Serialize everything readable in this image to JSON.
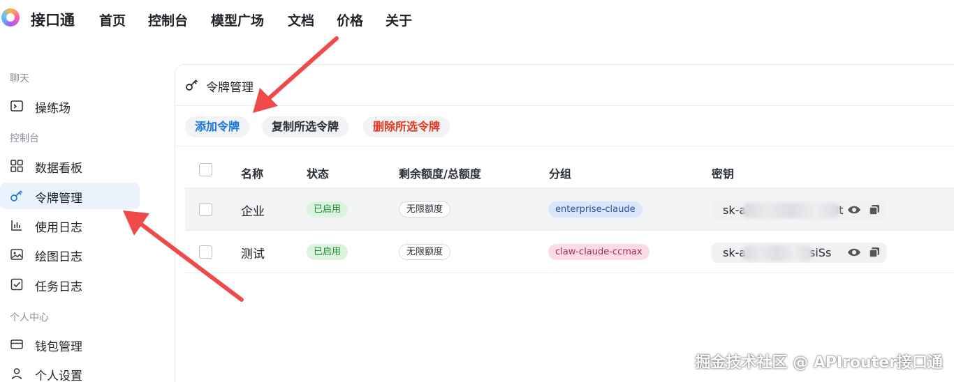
{
  "nav": {
    "brand": "接口通",
    "items": [
      "首页",
      "控制台",
      "模型广场",
      "文档",
      "价格",
      "关于"
    ]
  },
  "sidebar": {
    "sections": [
      "聊天",
      "控制台",
      "个人中心"
    ],
    "items": [
      {
        "label": "操练场",
        "icon": "terminal-icon"
      },
      {
        "label": "数据看板",
        "icon": "dashboard-icon"
      },
      {
        "label": "令牌管理",
        "icon": "key-icon",
        "active": true
      },
      {
        "label": "使用日志",
        "icon": "bar-chart-icon"
      },
      {
        "label": "绘图日志",
        "icon": "image-icon"
      },
      {
        "label": "任务日志",
        "icon": "checkbox-icon"
      },
      {
        "label": "钱包管理",
        "icon": "wallet-icon"
      },
      {
        "label": "个人设置",
        "icon": "user-icon"
      }
    ]
  },
  "main": {
    "title": "令牌管理",
    "buttons": {
      "add": "添加令牌",
      "copy_selected": "复制所选令牌",
      "delete_selected": "删除所选令牌"
    },
    "columns": [
      "名称",
      "状态",
      "剩余额度/总额度",
      "分组",
      "密钥"
    ],
    "rows": [
      {
        "name": "企业",
        "status": "已启用",
        "quota": "无限额度",
        "group": "enterprise-claude",
        "key": "sk-aT4",
        "key_end": "0t"
      },
      {
        "name": "测试",
        "status": "已启用",
        "quota": "无限额度",
        "group": "claw-claude-ccmax",
        "key": "sk-a",
        "key_end": "siSs"
      }
    ]
  },
  "watermark": "掘金技术社区 @ APIrouter接口通",
  "colors": {
    "accent": "#1677e6",
    "danger": "#e5391f",
    "annotation_arrow": "#ef4a4a"
  }
}
